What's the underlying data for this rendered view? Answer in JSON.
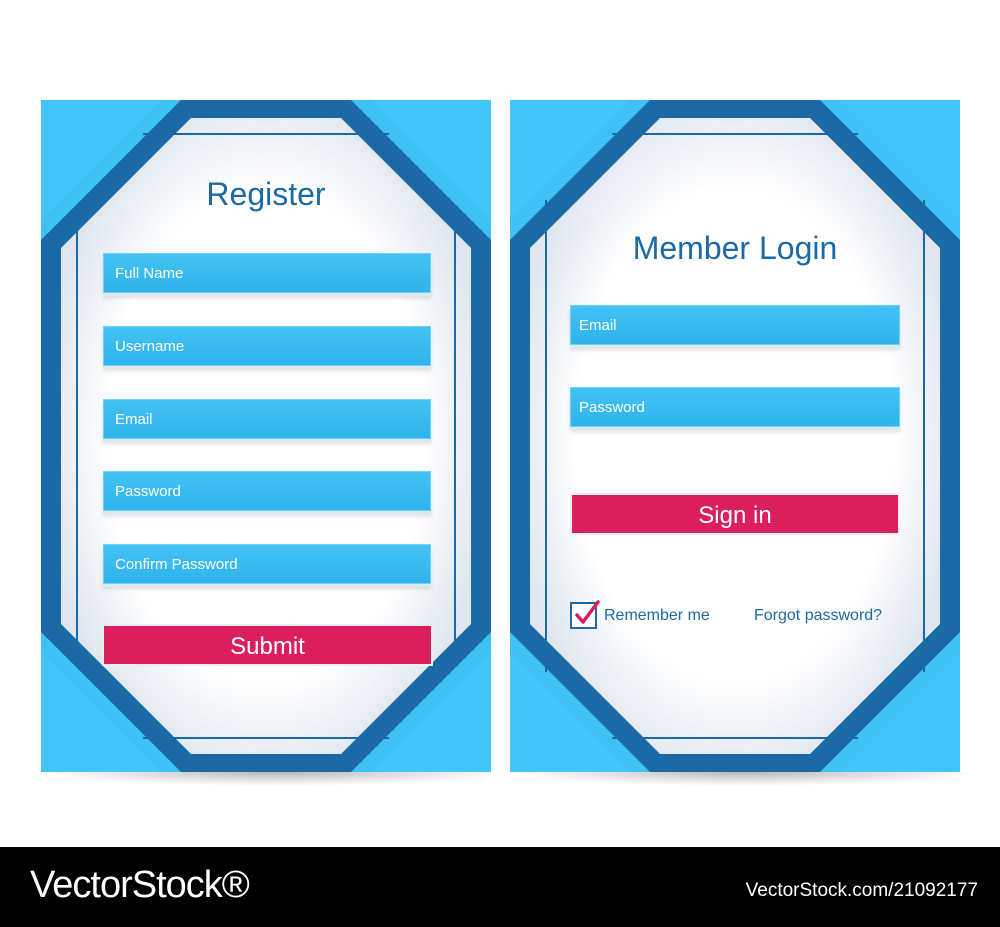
{
  "register": {
    "title": "Register",
    "fields": [
      "Full Name",
      "Username",
      "Email",
      "Password",
      "Confirm Password"
    ],
    "submit": "Submit"
  },
  "login": {
    "title": "Member Login",
    "fields": [
      "Email",
      "Password"
    ],
    "signin": "Sign in",
    "remember": "Remember me",
    "forgot": "Forgot password?",
    "remember_checked": true
  },
  "footer": {
    "logo": "VectorStock®",
    "id_text": "VectorStock.com/21092177"
  },
  "colors": {
    "light_blue": "#3fc1f5",
    "dark_blue": "#1b6aa5",
    "button": "#da1f5c"
  }
}
